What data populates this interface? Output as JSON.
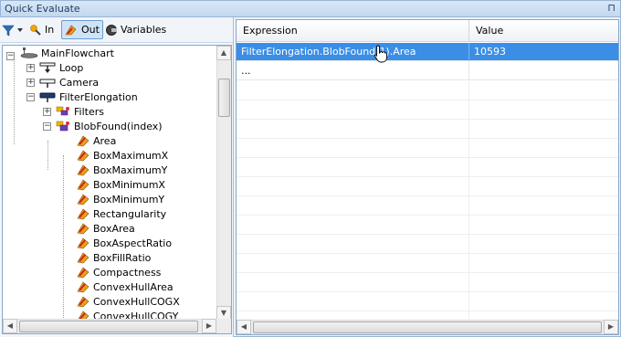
{
  "window": {
    "title": "Quick Evaluate",
    "pin_glyph": "⊓"
  },
  "toolbar": {
    "in_label": "In",
    "out_label": "Out",
    "variables_label": "Variables"
  },
  "tree": {
    "nodes": [
      {
        "label": "MainFlowchart",
        "icon": "flowchart-icon"
      },
      {
        "label": "Loop",
        "icon": "loop-icon"
      },
      {
        "label": "Camera",
        "icon": "camera-task-icon"
      },
      {
        "label": "FilterElongation",
        "icon": "filter-task-icon"
      },
      {
        "label": "Filters",
        "icon": "filters-property-icon"
      },
      {
        "label": "BlobFound(index)",
        "icon": "blob-property-icon"
      },
      {
        "label": "Area",
        "icon": "property-icon"
      },
      {
        "label": "BoxMaximumX",
        "icon": "property-icon"
      },
      {
        "label": "BoxMaximumY",
        "icon": "property-icon"
      },
      {
        "label": "BoxMinimumX",
        "icon": "property-icon"
      },
      {
        "label": "BoxMinimumY",
        "icon": "property-icon"
      },
      {
        "label": "Rectangularity",
        "icon": "property-icon"
      },
      {
        "label": "BoxArea",
        "icon": "property-icon"
      },
      {
        "label": "BoxAspectRatio",
        "icon": "property-icon"
      },
      {
        "label": "BoxFillRatio",
        "icon": "property-icon"
      },
      {
        "label": "Compactness",
        "icon": "property-icon"
      },
      {
        "label": "ConvexHullArea",
        "icon": "property-icon"
      },
      {
        "label": "ConvexHullCOGX",
        "icon": "property-icon"
      },
      {
        "label": "ConvexHullCOGY",
        "icon": "property-icon"
      }
    ]
  },
  "grid": {
    "columns": {
      "expression": "Expression",
      "value": "Value"
    },
    "rows": [
      {
        "expression": "FilterElongation.BlobFound(1).Area",
        "value": "10593"
      },
      {
        "expression": "...",
        "value": ""
      }
    ]
  },
  "colors": {
    "selection": "#3a8ee6",
    "titlebar": "#c3d8ee"
  }
}
